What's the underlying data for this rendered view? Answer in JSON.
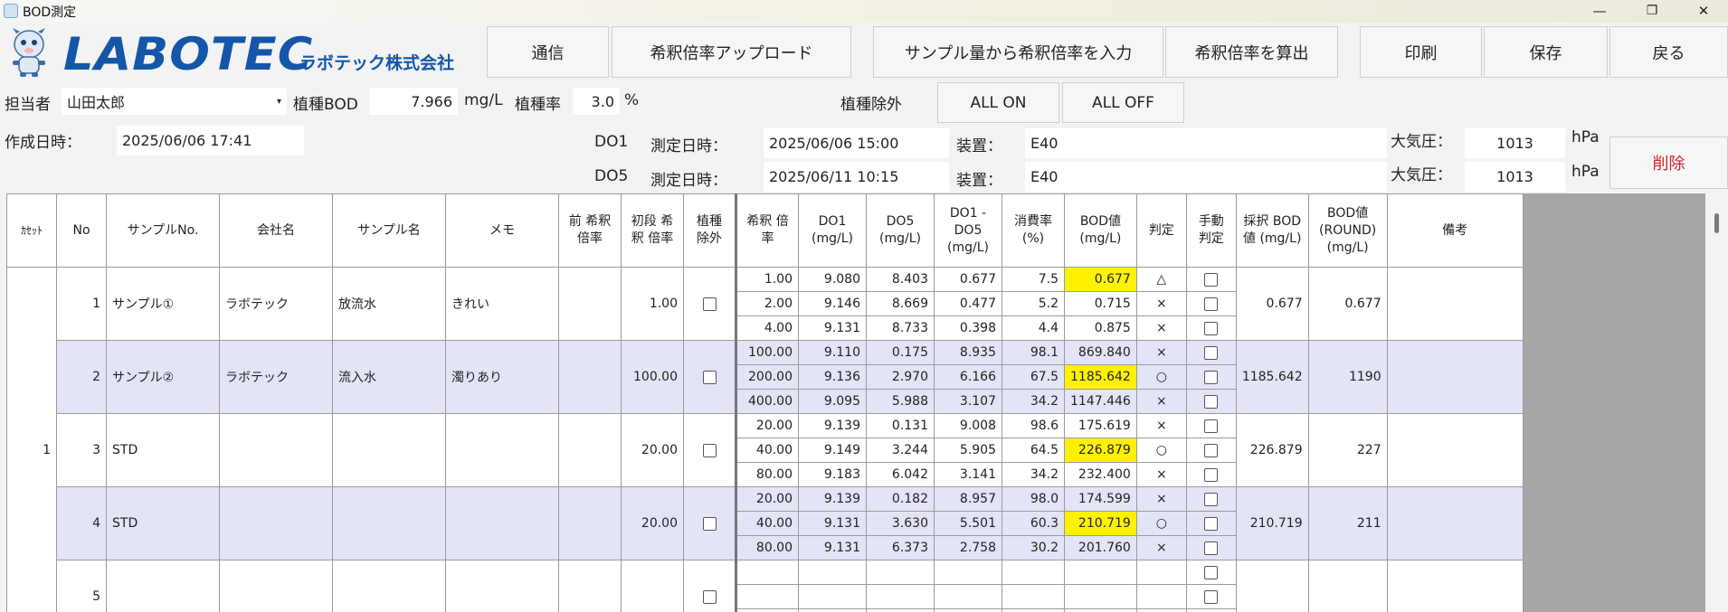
{
  "window": {
    "title": "BOD測定",
    "minimize": "—",
    "maximize": "❐",
    "close": "✕"
  },
  "logo": {
    "brand": "LABOTEC",
    "company": "ラボテック株式会社"
  },
  "toolbar": {
    "comm": "通信",
    "upload": "希釈倍率アップロード",
    "input_from_sample": "サンプル量から希釈倍率を入力",
    "calc": "希釈倍率を算出",
    "print": "印刷",
    "save": "保存",
    "back": "戻る"
  },
  "form": {
    "person_label": "担当者",
    "person_value": "山田太郎",
    "seed_bod_label": "植種BOD",
    "seed_bod_value": "7.966",
    "seed_bod_unit": "mg/L",
    "seed_rate_label": "植種率",
    "seed_rate_value": "3.0",
    "seed_rate_unit": "%",
    "seed_exclude_label": "植種除外",
    "all_on": "ALL ON",
    "all_off": "ALL OFF",
    "created_label": "作成日時：",
    "created_value": "2025/06/06 17:41",
    "do1_label": "DO1",
    "do5_label": "DO5",
    "measure_label": "測定日時：",
    "do1_datetime": "2025/06/06 15:00",
    "do5_datetime": "2025/06/11 10:15",
    "device_label": "装置：",
    "do1_device": "E40",
    "do5_device": "E40",
    "pressure_label": "大気圧：",
    "do1_pressure": "1013",
    "do5_pressure": "1013",
    "pressure_unit": "hPa",
    "delete": "削除"
  },
  "table": {
    "headers": {
      "cassette": "ｶｾｯﾄ",
      "no": "No",
      "sample_no": "サンプルNo.",
      "company": "会社名",
      "sample_name": "サンプル名",
      "memo": "メモ",
      "prev_dilution": "前 希釈 倍率",
      "init_dilution": "初段 希釈 倍率",
      "seed_exclude": "植種 除外",
      "dilution": "希釈 倍率",
      "do1": "DO1 (mg/L)",
      "do5": "DO5 (mg/L)",
      "do_diff": "DO1 -DO5 (mg/L)",
      "consumption": "消費率 (%)",
      "bod": "BOD値 (mg/L)",
      "judge": "判定",
      "manual_judge": "手動 判定",
      "adopted_bod": "採択 BOD値 (mg/L)",
      "bod_round": "BOD値 (ROUND) (mg/L)",
      "remarks": "備考"
    },
    "groups": [
      {
        "cassette": "1",
        "no": "1",
        "sample_no": "サンプル①",
        "company": "ラボテック",
        "sample_name": "放流水",
        "memo": "きれい",
        "init_dilution": "1.00",
        "adopted": "0.677",
        "round": "0.677",
        "rows": [
          {
            "dil": "1.00",
            "do1": "9.080",
            "do5": "8.403",
            "diff": "0.677",
            "rate": "7.5",
            "bod": "0.677",
            "judge": "△",
            "hl": true
          },
          {
            "dil": "2.00",
            "do1": "9.146",
            "do5": "8.669",
            "diff": "0.477",
            "rate": "5.2",
            "bod": "0.715",
            "judge": "×",
            "hl": false
          },
          {
            "dil": "4.00",
            "do1": "9.131",
            "do5": "8.733",
            "diff": "0.398",
            "rate": "4.4",
            "bod": "0.875",
            "judge": "×",
            "hl": false
          }
        ]
      },
      {
        "cassette": "",
        "no": "2",
        "sample_no": "サンプル②",
        "company": "ラボテック",
        "sample_name": "流入水",
        "memo": "濁りあり",
        "init_dilution": "100.00",
        "adopted": "1185.642",
        "round": "1190",
        "rows": [
          {
            "dil": "100.00",
            "do1": "9.110",
            "do5": "0.175",
            "diff": "8.935",
            "rate": "98.1",
            "bod": "869.840",
            "judge": "×",
            "hl": false
          },
          {
            "dil": "200.00",
            "do1": "9.136",
            "do5": "2.970",
            "diff": "6.166",
            "rate": "67.5",
            "bod": "1185.642",
            "judge": "○",
            "hl": true
          },
          {
            "dil": "400.00",
            "do1": "9.095",
            "do5": "5.988",
            "diff": "3.107",
            "rate": "34.2",
            "bod": "1147.446",
            "judge": "×",
            "hl": false
          }
        ]
      },
      {
        "cassette": "",
        "no": "3",
        "sample_no": "STD",
        "company": "",
        "sample_name": "",
        "memo": "",
        "init_dilution": "20.00",
        "adopted": "226.879",
        "round": "227",
        "rows": [
          {
            "dil": "20.00",
            "do1": "9.139",
            "do5": "0.131",
            "diff": "9.008",
            "rate": "98.6",
            "bod": "175.619",
            "judge": "×",
            "hl": false
          },
          {
            "dil": "40.00",
            "do1": "9.149",
            "do5": "3.244",
            "diff": "5.905",
            "rate": "64.5",
            "bod": "226.879",
            "judge": "○",
            "hl": true
          },
          {
            "dil": "80.00",
            "do1": "9.183",
            "do5": "6.042",
            "diff": "3.141",
            "rate": "34.2",
            "bod": "232.400",
            "judge": "×",
            "hl": false
          }
        ]
      },
      {
        "cassette": "",
        "no": "4",
        "sample_no": "STD",
        "company": "",
        "sample_name": "",
        "memo": "",
        "init_dilution": "20.00",
        "adopted": "210.719",
        "round": "211",
        "rows": [
          {
            "dil": "20.00",
            "do1": "9.139",
            "do5": "0.182",
            "diff": "8.957",
            "rate": "98.0",
            "bod": "174.599",
            "judge": "×",
            "hl": false
          },
          {
            "dil": "40.00",
            "do1": "9.131",
            "do5": "3.630",
            "diff": "5.501",
            "rate": "60.3",
            "bod": "210.719",
            "judge": "○",
            "hl": true
          },
          {
            "dil": "80.00",
            "do1": "9.131",
            "do5": "6.373",
            "diff": "2.758",
            "rate": "30.2",
            "bod": "201.760",
            "judge": "×",
            "hl": false
          }
        ]
      },
      {
        "cassette": "",
        "no": "5",
        "sample_no": "",
        "company": "",
        "sample_name": "",
        "memo": "",
        "init_dilution": "",
        "adopted": "",
        "round": "",
        "rows": [
          {
            "dil": "",
            "do1": "",
            "do5": "",
            "diff": "",
            "rate": "",
            "bod": "",
            "judge": "",
            "hl": false
          },
          {
            "dil": "",
            "do1": "",
            "do5": "",
            "diff": "",
            "rate": "",
            "bod": "",
            "judge": "",
            "hl": false
          },
          {
            "dil": "",
            "do1": "",
            "do5": "",
            "diff": "",
            "rate": "",
            "bod": "",
            "judge": "",
            "hl": false
          }
        ]
      }
    ]
  }
}
